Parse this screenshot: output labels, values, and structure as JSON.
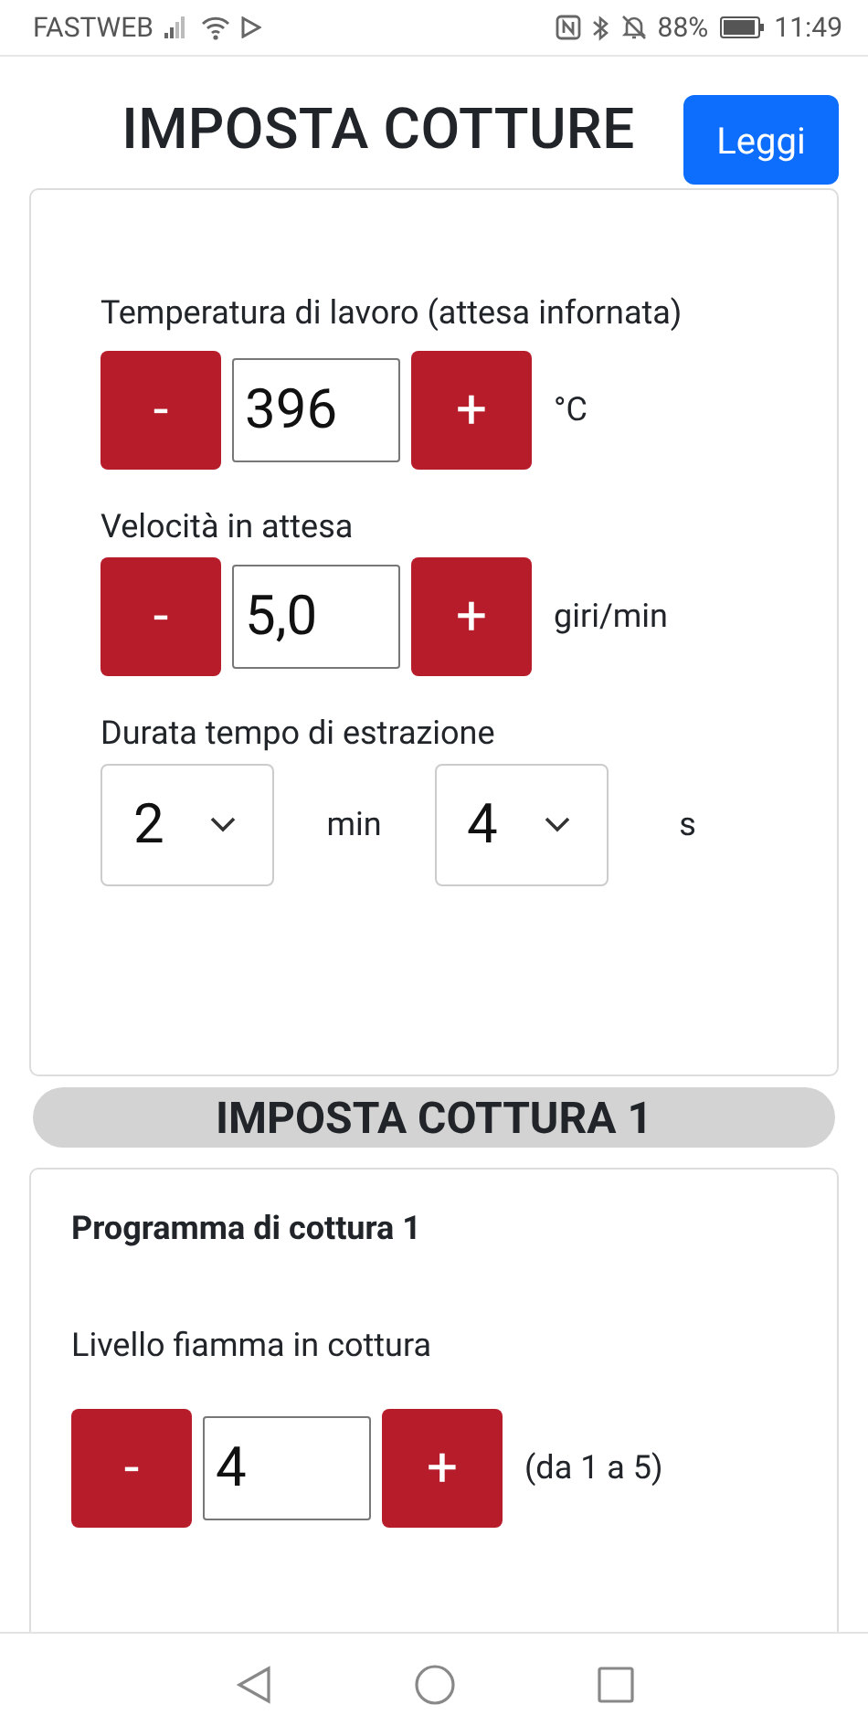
{
  "status_bar": {
    "carrier": "FASTWEB",
    "battery": "88%",
    "time": "11:49"
  },
  "header": {
    "title": "IMPOSTA COTTURE",
    "read_button": "Leggi"
  },
  "settings_card": {
    "rows": [
      {
        "kind": "stepper",
        "label": "Temperatura di lavoro (attesa infornata)",
        "minus": "-",
        "value": "396",
        "plus": "+",
        "unit": "°C"
      },
      {
        "kind": "stepper",
        "label": "Velocità in attesa",
        "minus": "-",
        "value": "5,0",
        "plus": "+",
        "unit": "giri/min"
      },
      {
        "kind": "duration",
        "label": "Durata tempo di estrazione",
        "selects": [
          {
            "value": "2",
            "unit": "min"
          },
          {
            "value": "4",
            "unit": "s"
          }
        ]
      }
    ]
  },
  "section_title": "IMPOSTA COTTURA 1",
  "program_card": {
    "title": "Programma di cottura 1",
    "rows": [
      {
        "kind": "stepper",
        "label": "Livello fiamma in cottura",
        "minus": "-",
        "value": "4",
        "plus": "+",
        "unit": "(da 1 a 5)"
      }
    ]
  }
}
